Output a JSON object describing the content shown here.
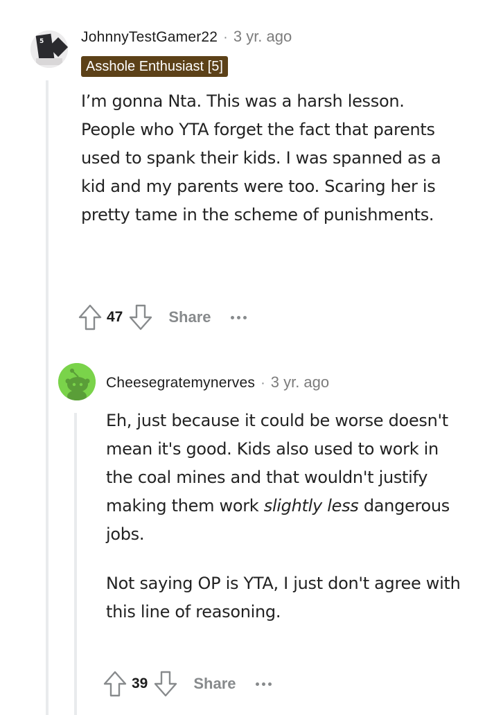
{
  "comments": [
    {
      "username": "JohnnyTestGamer22",
      "separator": "·",
      "timestamp": "3 yr. ago",
      "flair": "Asshole Enthusiast [5]",
      "avatar": "playing-card-avatar-icon",
      "body": "I’m gonna Nta. This was a harsh lesson. People who YTA forget the fact that parents used to spank their kids. I was spanned as a kid and my parents were too. Scaring her is pretty tame in the scheme of punishments.",
      "votes": "47",
      "share_label": "Share"
    },
    {
      "username": "Cheesegratemynerves",
      "separator": "·",
      "timestamp": "3 yr. ago",
      "avatar": "reddit-snoo-avatar-icon",
      "avatar_color": "#7ad34a",
      "body_p1_before": "Eh, just because it could be worse doesn't mean it's good. Kids also used to work in the coal mines and that wouldn't justify making them work ",
      "body_p1_em": "slightly less",
      "body_p1_after": " dangerous jobs.",
      "body_p2": "Not saying OP is YTA, I just don't agree with this line of reasoning.",
      "votes": "39",
      "share_label": "Share"
    }
  ],
  "colors": {
    "flair_bg": "#5c4118",
    "muted": "#878a8c",
    "thread_line": "#e9ebed"
  }
}
